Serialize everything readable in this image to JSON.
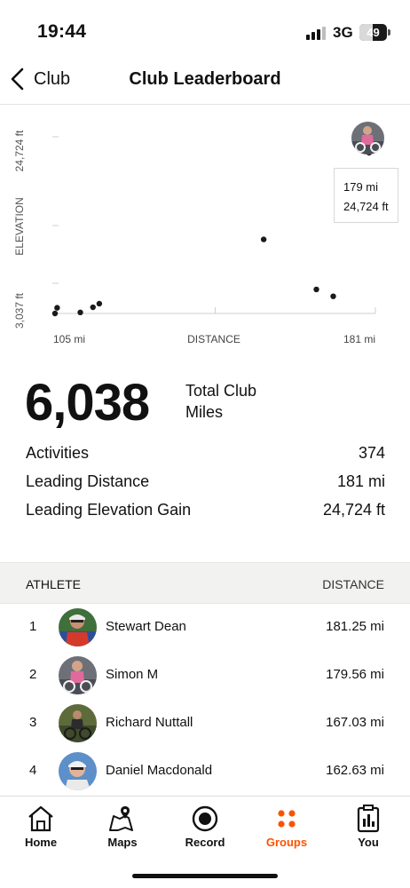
{
  "status_bar": {
    "time": "19:44",
    "network": "3G",
    "battery": "49"
  },
  "nav": {
    "back_label": "Club",
    "title": "Club Leaderboard"
  },
  "chart_data": {
    "type": "scatter",
    "xlabel": "DISTANCE",
    "ylabel": "ELEVATION",
    "x_tick_labels": [
      "105 mi",
      "181 mi"
    ],
    "y_tick_labels": [
      "3,037 ft",
      "24,724 ft"
    ],
    "xlim": [
      105,
      181
    ],
    "ylim": [
      3037,
      24724
    ],
    "points": [
      {
        "x": 105.0,
        "y": 3037
      },
      {
        "x": 105.5,
        "y": 3800
      },
      {
        "x": 111.0,
        "y": 3180
      },
      {
        "x": 114.0,
        "y": 3870
      },
      {
        "x": 115.5,
        "y": 4360
      },
      {
        "x": 154.5,
        "y": 13030
      },
      {
        "x": 167.0,
        "y": 6280
      },
      {
        "x": 171.0,
        "y": 5350
      },
      {
        "x": 179.5,
        "y": 24724
      }
    ],
    "highlight": {
      "x": 179.5,
      "y": 24724,
      "label_distance": "179 mi",
      "label_elevation": "24,724 ft"
    }
  },
  "summary": {
    "total": "6,038",
    "total_label": "Total Club Miles",
    "stats": [
      {
        "label": "Activities",
        "value": "374"
      },
      {
        "label": "Leading Distance",
        "value": "181 mi"
      },
      {
        "label": "Leading Elevation Gain",
        "value": "24,724 ft"
      }
    ]
  },
  "table": {
    "header_athlete": "ATHLETE",
    "header_distance": "DISTANCE",
    "rows": [
      {
        "rank": "1",
        "name": "Stewart Dean",
        "distance": "181.25 mi"
      },
      {
        "rank": "2",
        "name": "Simon M",
        "distance": "179.56 mi"
      },
      {
        "rank": "3",
        "name": "Richard Nuttall",
        "distance": "167.03 mi"
      },
      {
        "rank": "4",
        "name": "Daniel Macdonald",
        "distance": "162.63 mi"
      }
    ]
  },
  "tabbar": {
    "home": "Home",
    "maps": "Maps",
    "record": "Record",
    "groups": "Groups",
    "you": "You",
    "active": "groups",
    "accent_color": "#fc5200"
  }
}
